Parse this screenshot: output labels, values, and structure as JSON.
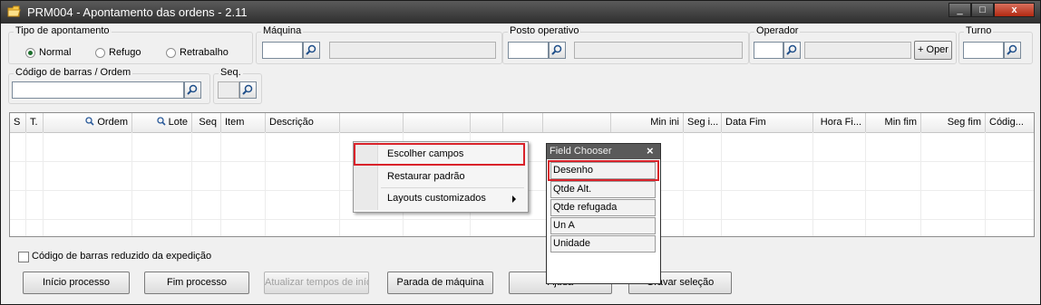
{
  "window": {
    "title": "PRM004 - Apontamento das ordens - 2.11",
    "controls": [
      "_",
      "□",
      "x"
    ],
    "close_color": "#c0321a"
  },
  "filters": {
    "tipo_apontamento": {
      "label": "Tipo de apontamento",
      "options": [
        "Normal",
        "Refugo",
        "Retrabalho"
      ],
      "selected": "Normal"
    },
    "maquina": {
      "label": "Máquina",
      "code": "",
      "description": ""
    },
    "posto_operativo": {
      "label": "Posto operativo",
      "code": "",
      "description": ""
    },
    "operador": {
      "label": "Operador",
      "code": "",
      "description": "",
      "add_button": "+ Oper"
    },
    "turno": {
      "label": "Turno",
      "code": ""
    },
    "codigo_barras": {
      "label": "Código de barras / Ordem",
      "value": ""
    },
    "seq": {
      "label": "Seq.",
      "value": ""
    }
  },
  "grid": {
    "columns": [
      "S",
      "T.",
      "Ordem",
      "Lote",
      "Seq",
      "Item",
      "Descrição",
      "",
      "",
      "",
      "",
      "",
      "Min ini",
      "Seg i...",
      "Data Fim",
      "Hora Fi...",
      "Min fim",
      "Seg fim",
      "Códig..."
    ],
    "rows": []
  },
  "context_menu": {
    "items": [
      "Escolher campos",
      "Restaurar padrão",
      "Layouts customizados"
    ],
    "highlighted": "Escolher campos"
  },
  "field_chooser": {
    "title": "Field Chooser",
    "close": "×",
    "items": [
      "Desenho",
      "Qtde Alt.",
      "Qtde refugada",
      "Un A",
      "Unidade"
    ],
    "highlighted": "Desenho"
  },
  "options": {
    "codigo_reduzido": {
      "label": "Código de barras reduzido da expedição",
      "checked": false
    }
  },
  "buttons": {
    "inicio": "Início processo",
    "fim": "Fim processo",
    "atualizar": "Atualizar tempos de início",
    "parada": "Parada de máquina",
    "ajuda": "Ajuda",
    "gravar": "Gravar seleção"
  },
  "colors": {
    "highlight_border": "#d9222a",
    "field_chooser_title": "#5a5a5a"
  },
  "icons": [
    "folder-icon",
    "search-icon",
    "zoom-icon",
    "submenu-arrow-icon"
  ]
}
